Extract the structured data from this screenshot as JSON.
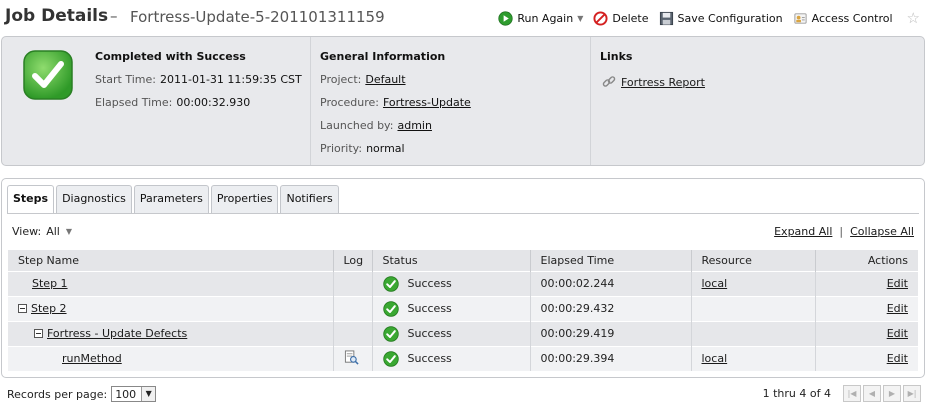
{
  "header": {
    "title": "Job Details",
    "separator": "–",
    "job_name": "Fortress-Update-5-201101311159",
    "actions": [
      {
        "label": "Run Again",
        "icon": "play-icon"
      },
      {
        "label": "Delete",
        "icon": "delete-icon"
      },
      {
        "label": "Save Configuration",
        "icon": "save-icon"
      },
      {
        "label": "Access Control",
        "icon": "access-control-icon"
      }
    ],
    "favorite_icon": "star-icon"
  },
  "summary": {
    "status_title": "Completed with Success",
    "start_time_label": "Start Time:",
    "start_time": "2011-01-31 11:59:35 CST",
    "elapsed_label": "Elapsed Time:",
    "elapsed": "00:00:32.930",
    "general_title": "General Information",
    "project_label": "Project:",
    "project": "Default",
    "procedure_label": "Procedure:",
    "procedure": "Fortress-Update",
    "launched_label": "Launched by:",
    "launched": "admin",
    "priority_label": "Priority:",
    "priority": "normal",
    "links_title": "Links",
    "link": "Fortress Report"
  },
  "tabs": [
    {
      "label": "Steps",
      "active": true
    },
    {
      "label": "Diagnostics"
    },
    {
      "label": "Parameters"
    },
    {
      "label": "Properties"
    },
    {
      "label": "Notifiers"
    }
  ],
  "view": {
    "label": "View:",
    "value": "All"
  },
  "expand_all": "Expand All",
  "collapse_all": "Collapse All",
  "columns": [
    "Step Name",
    "Log",
    "Status",
    "Elapsed Time",
    "Resource",
    "Actions"
  ],
  "rows": [
    {
      "name": "Step 1",
      "indent": 0,
      "tree": false,
      "log": false,
      "status": "Success",
      "elapsed": "00:00:02.244",
      "resource": "local",
      "action": "Edit"
    },
    {
      "name": "Step 2",
      "indent": 0,
      "tree": true,
      "log": false,
      "status": "Success",
      "elapsed": "00:00:29.432",
      "resource": "",
      "action": "Edit"
    },
    {
      "name": "Fortress - Update Defects",
      "indent": 1,
      "tree": true,
      "log": false,
      "status": "Success",
      "elapsed": "00:00:29.419",
      "resource": "",
      "action": "Edit"
    },
    {
      "name": "runMethod",
      "indent": 2,
      "tree": false,
      "log": true,
      "status": "Success",
      "elapsed": "00:00:29.394",
      "resource": "local",
      "action": "Edit"
    }
  ],
  "footer": {
    "records_label": "Records per page:",
    "records_value": "100",
    "range": "1 thru 4 of 4"
  },
  "colors": {
    "success": "#3aa832",
    "delete": "#d42020",
    "play": "#2e9c2e"
  }
}
